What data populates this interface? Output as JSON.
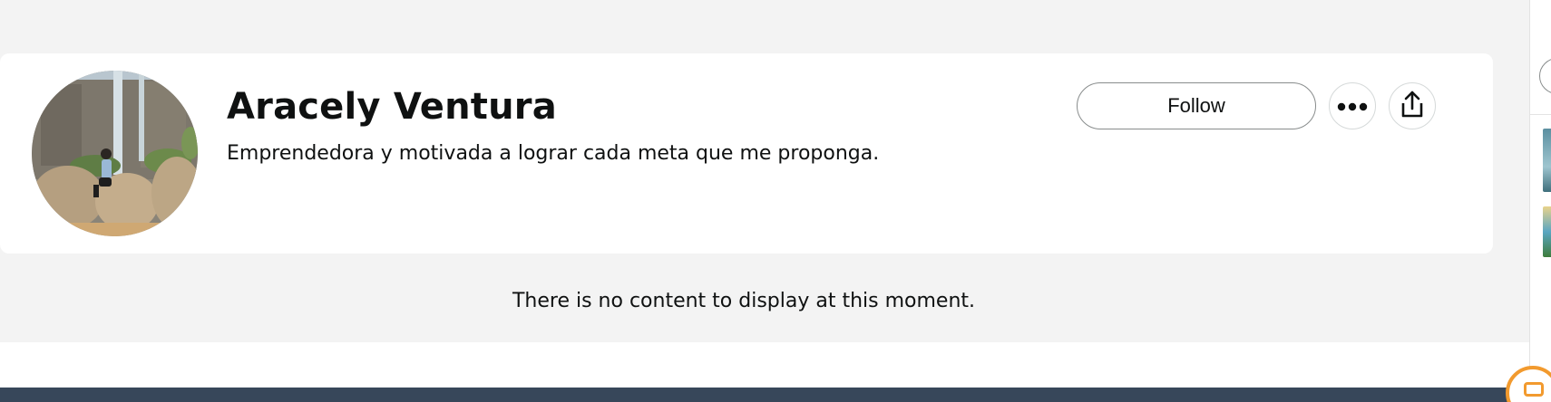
{
  "profile": {
    "name": "Aracely Ventura",
    "bio": "Emprendedora y motivada a lograr cada meta que me proponga.",
    "avatar_icon": "profile-photo",
    "actions": {
      "follow_label": "Follow",
      "more_icon": "more-dots-icon",
      "share_icon": "share-icon"
    }
  },
  "content": {
    "empty_message": "There is no content to display at this moment."
  },
  "colors": {
    "page_background": "#f3f3f3",
    "card_background": "#ffffff",
    "footer": "#37475a",
    "accent_orange": "#f29a2e"
  }
}
